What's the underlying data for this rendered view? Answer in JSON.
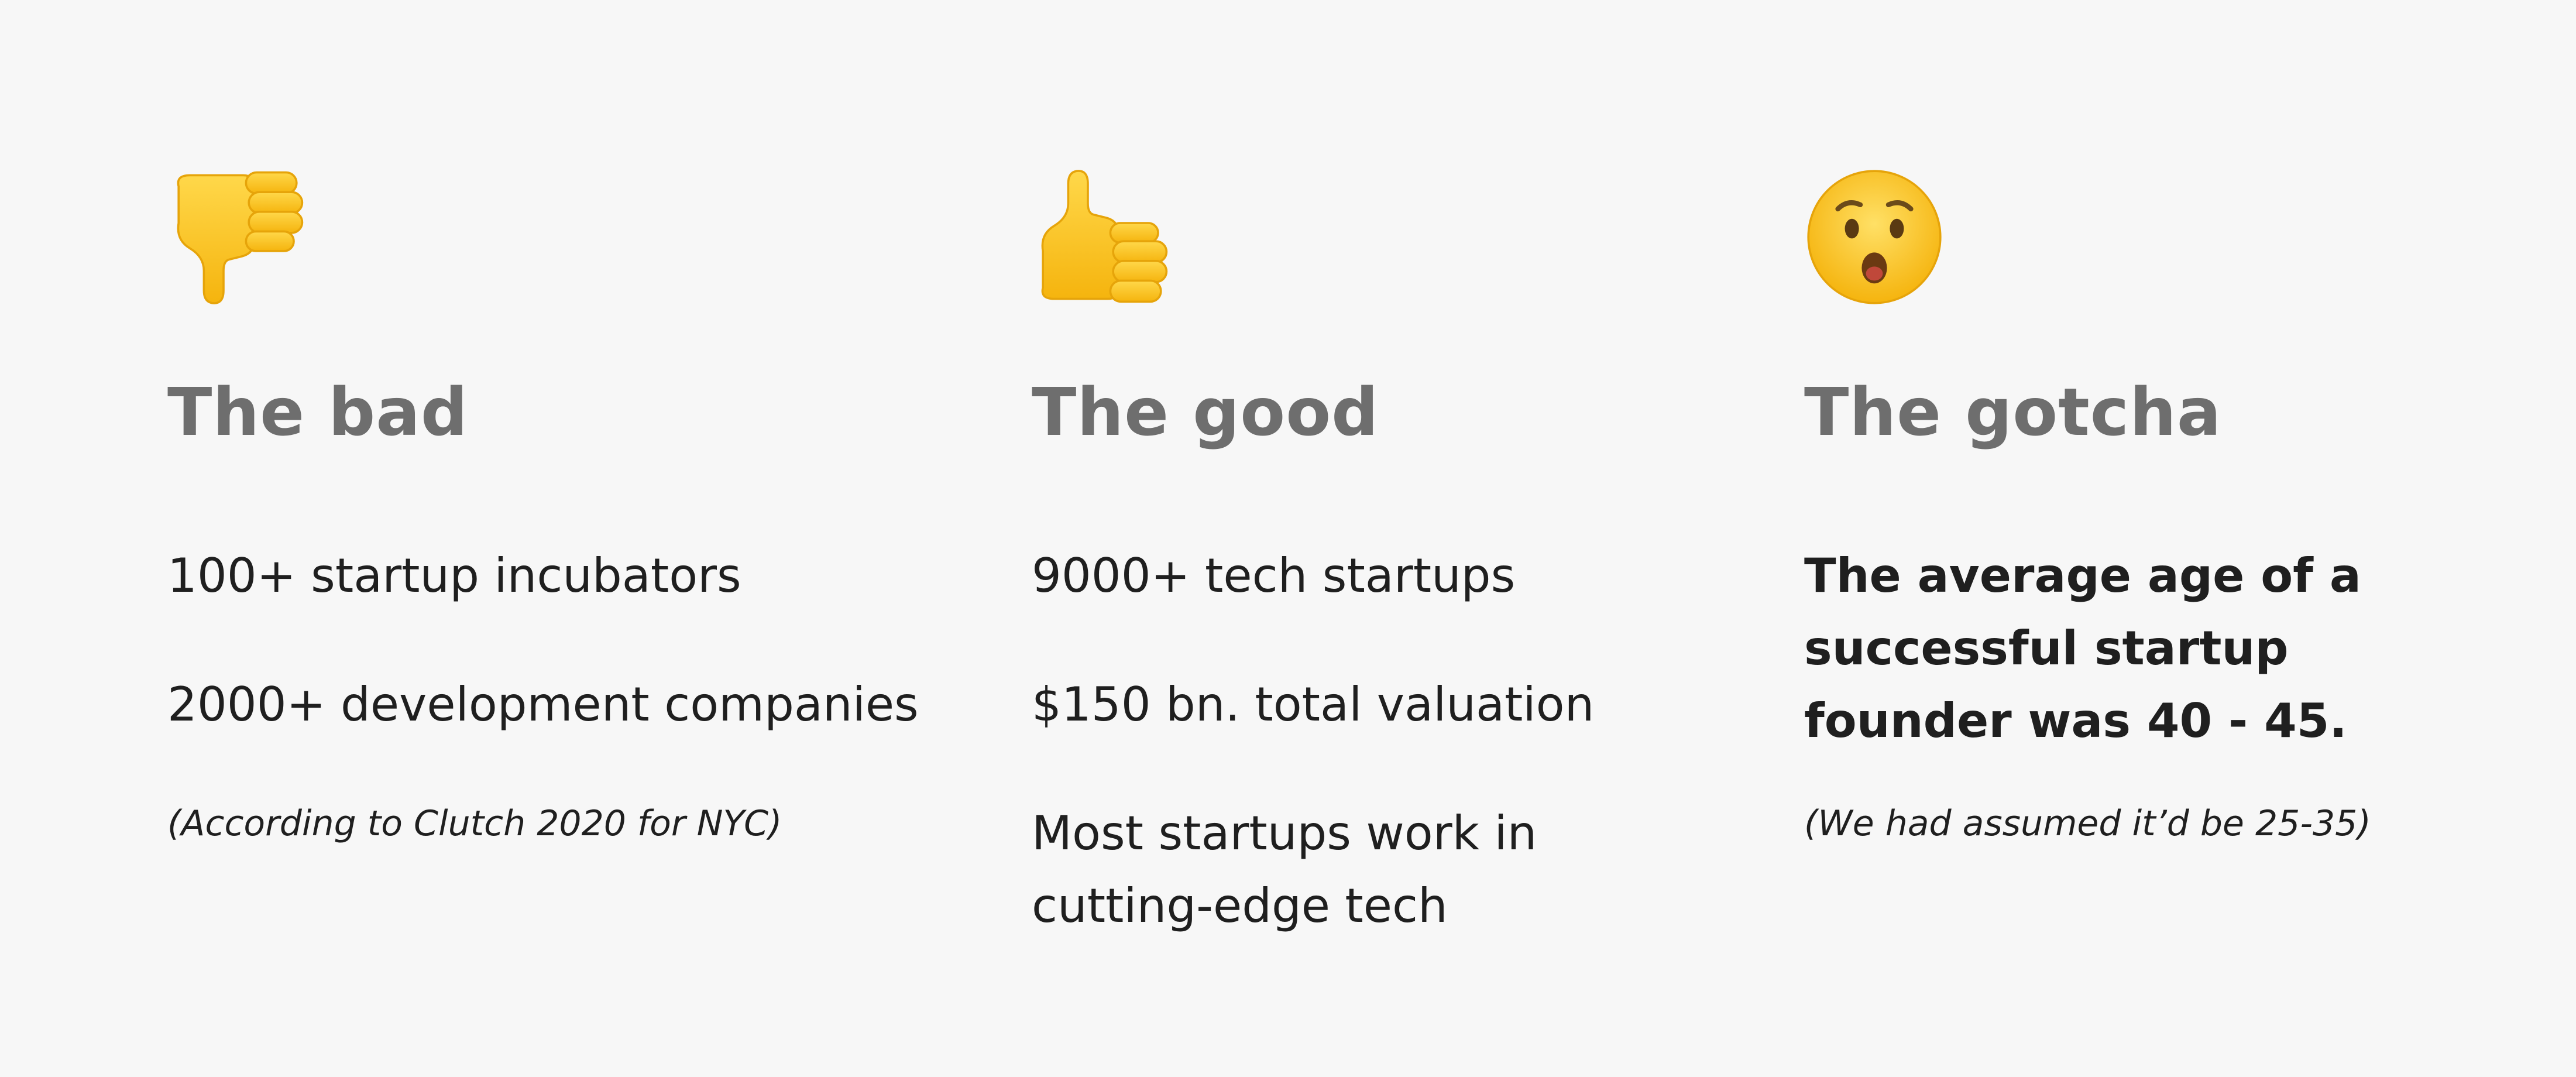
{
  "columns": [
    {
      "icon": "thumbs-down-icon",
      "heading": "The bad",
      "items": [
        "100+ startup incubators",
        "2000+ development companies"
      ],
      "note": "(According to Clutch 2020 for NYC)"
    },
    {
      "icon": "thumbs-up-icon",
      "heading": "The good",
      "items": [
        "9000+ tech startups",
        "$150 bn. total valuation",
        "Most startups work in cutting-edge tech"
      ]
    },
    {
      "icon": "hushed-face-icon",
      "heading": "The gotcha",
      "emphasis": "The average age of a successful startup founder was 40 - 45.",
      "note": "(We had assumed it’d be 25-35)"
    }
  ],
  "colors": {
    "background": "#f7f7f7",
    "heading": "#6e6e6e",
    "text": "#1f1f1f",
    "emoji_yellow": "#fcc21b"
  }
}
